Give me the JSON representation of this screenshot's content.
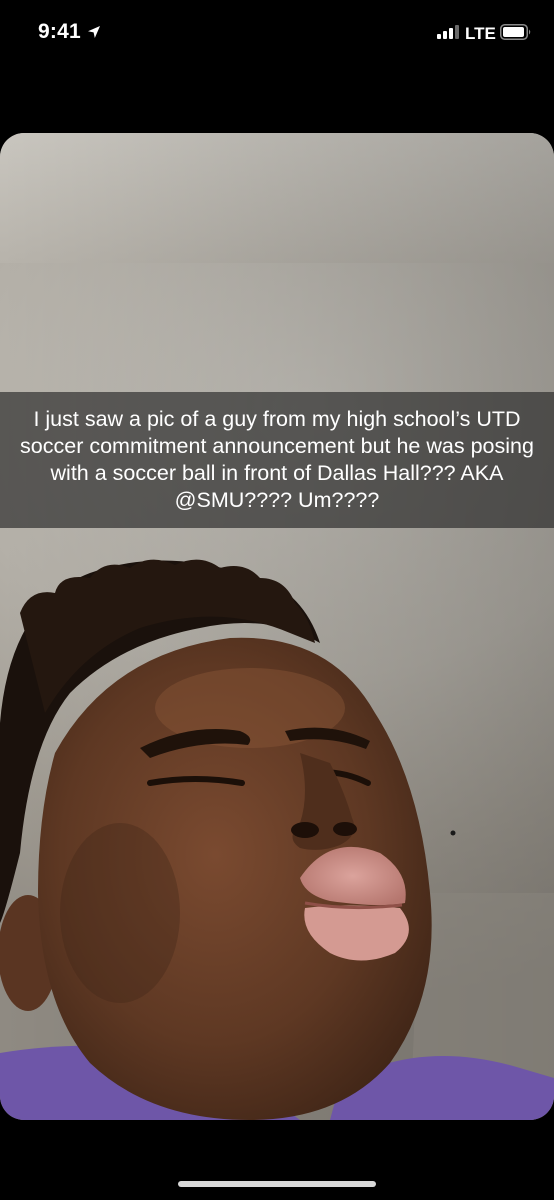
{
  "status_bar": {
    "time": "9:41",
    "network": "LTE",
    "icons": [
      "location-arrow-icon",
      "signal-bars-icon",
      "battery-icon"
    ]
  },
  "snap": {
    "caption": "I just saw a pic of a guy from my high school’s UTD soccer commitment announcement but he was posing with a soccer ball in front of Dallas Hall??? AKA @SMU???? Um????"
  },
  "colors": {
    "background": "#000000",
    "caption_bar": "rgba(40,40,40,0.66)",
    "wall": "#b4b0a8",
    "shirt": "#6e56a8"
  }
}
